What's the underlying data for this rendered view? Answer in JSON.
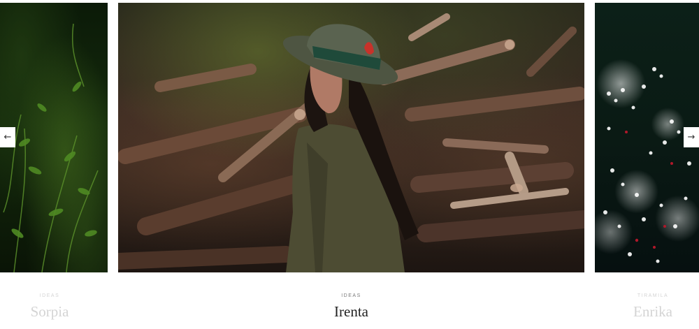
{
  "carousel": {
    "slides": [
      {
        "category": "Ideas",
        "title": "Sorpia",
        "image": "dark-green-foliage"
      },
      {
        "category": "Ideas",
        "title": "Irenta",
        "image": "woman-in-hat-with-logs"
      },
      {
        "category": "Tiramila",
        "title": "Enrika",
        "image": "white-flowers-dark-green"
      }
    ],
    "prev_label": "←",
    "next_label": "→",
    "active_index": 1
  },
  "colors": {
    "background": "#ffffff",
    "title_active": "#222222",
    "category_active": "#7a7a7a",
    "faded_text": "#d4d4d4"
  }
}
